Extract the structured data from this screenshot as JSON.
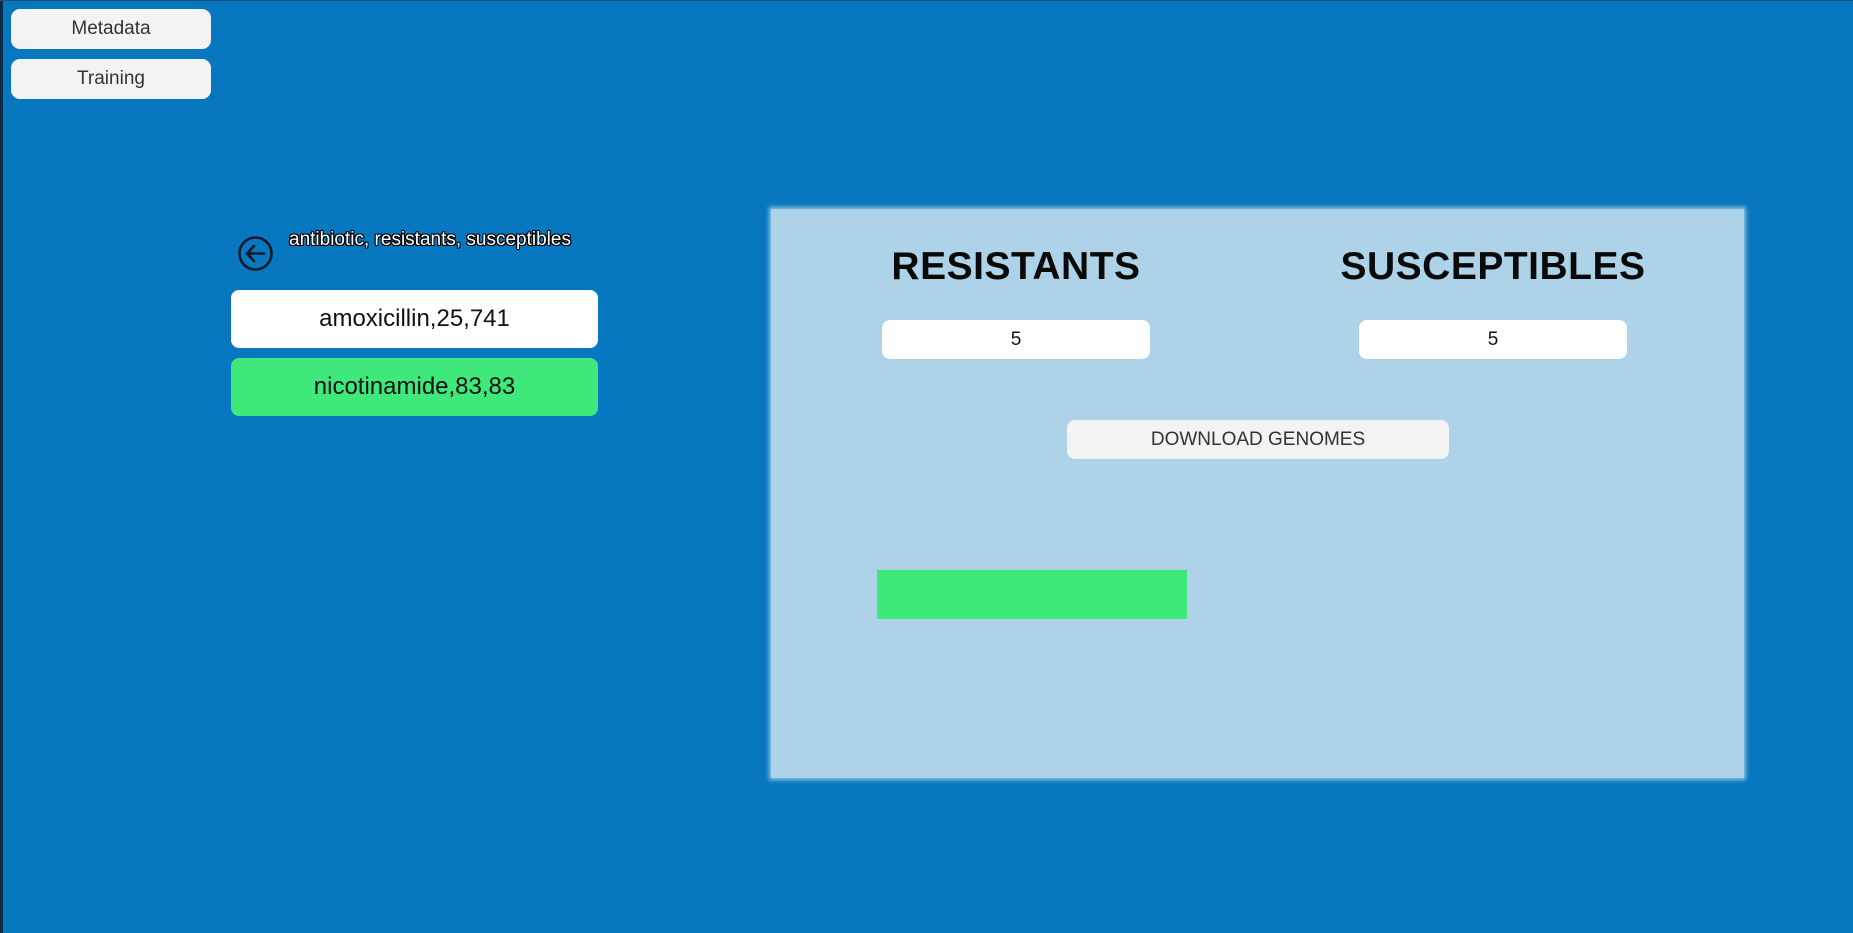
{
  "colors": {
    "background": "#0778bf",
    "panel": "#aed3e9",
    "selected_item": "#3ee87a",
    "default_item": "#ffffff",
    "button": "#f3f3f3",
    "progress": "#3ee87a"
  },
  "nav": {
    "metadata_label": "Metadata",
    "training_label": "Training"
  },
  "list": {
    "back_icon": "arrow-left-circle-icon",
    "header": "antibiotic, resistants, susceptibles",
    "items": [
      {
        "label": "amoxicillin,25,741",
        "selected": false
      },
      {
        "label": "nicotinamide,83,83",
        "selected": true
      }
    ]
  },
  "panel": {
    "resistants_title": "RESISTANTS",
    "susceptibles_title": "SUSCEPTIBLES",
    "resistants_value": "5",
    "susceptibles_value": "5",
    "download_label": "DOWNLOAD GENOMES",
    "progress_fraction": 1.0
  }
}
